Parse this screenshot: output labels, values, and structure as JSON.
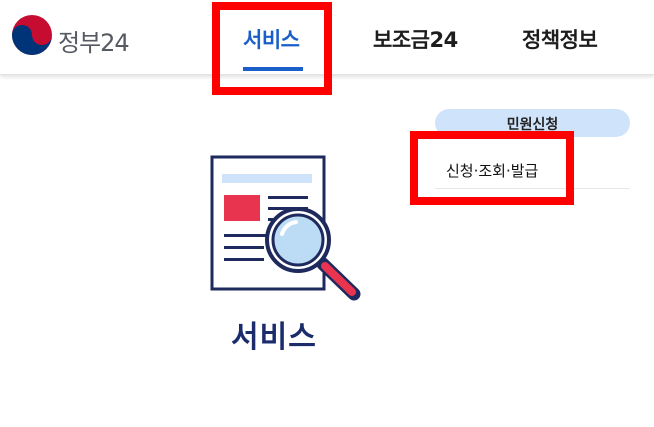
{
  "header": {
    "logo_text": "정부24",
    "tabs": [
      {
        "label": "서비스",
        "active": true
      },
      {
        "label": "보조금24",
        "active": false
      },
      {
        "label": "정책정보",
        "active": false
      }
    ]
  },
  "main": {
    "illustration_icon": "document-search-icon",
    "title": "서비스"
  },
  "submenu": {
    "group_label": "민원신청",
    "items": [
      {
        "label": "신청·조회·발급"
      }
    ]
  },
  "colors": {
    "accent": "#1a5fc9",
    "highlight": "#ff0000",
    "pill": "#cfe3fb",
    "title": "#1a2c6b"
  }
}
